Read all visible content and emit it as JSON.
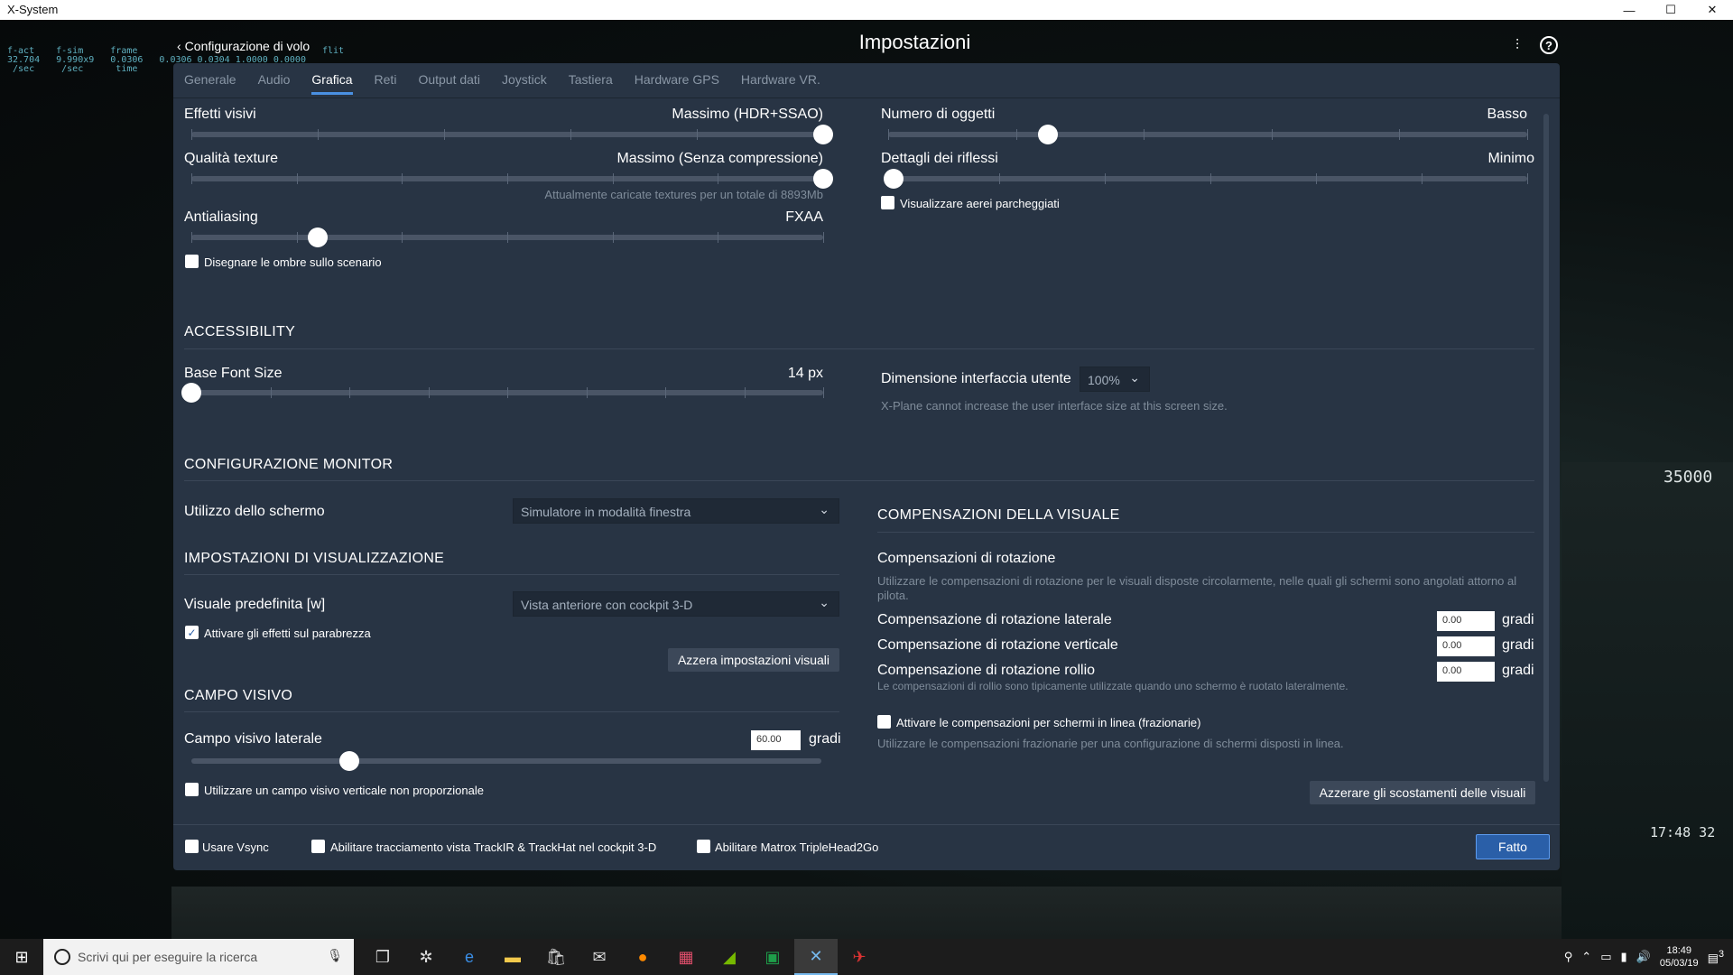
{
  "window": {
    "title": "X-System",
    "minimize": "—",
    "maximize": "☐",
    "close": "✕"
  },
  "stats": {
    "col1": "f-act\n32.704\n /sec",
    "col2": "f-sim\n9.990x9\n /sec",
    "col3": "frame\n0.0306\n time",
    "col4": "\n0.0306 0.0304 1.0000 0.0000",
    "col5": "flit\n"
  },
  "sim": {
    "altitude": "35000",
    "clock": "17:48 32"
  },
  "header": {
    "back_label": "Configurazione di volo",
    "title": "Impostazioni",
    "sliders_icon": "sliders-icon",
    "help_icon": "help-icon"
  },
  "tabs": [
    "Generale",
    "Audio",
    "Grafica",
    "Reti",
    "Output dati",
    "Joystick",
    "Tastiera",
    "Hardware GPS",
    "Hardware VR."
  ],
  "active_tab": "Grafica",
  "graphics": {
    "visual_effects": {
      "label": "Effetti visivi",
      "value": "Massimo (HDR+SSAO)",
      "level": 1.0,
      "ticks": 5
    },
    "texture_quality": {
      "label": "Qualità texture",
      "value": "Massimo (Senza compressione)",
      "level": 1.0,
      "ticks": 6,
      "note": "Attualmente caricate textures per un totale di 8893Mb"
    },
    "antialiasing": {
      "label": "Antialiasing",
      "value": "FXAA",
      "level": 0.2,
      "ticks": 6
    },
    "shadows": {
      "label": "Disegnare le ombre sullo scenario",
      "checked": false
    },
    "object_count": {
      "label": "Numero di oggetti",
      "value": "Basso",
      "level": 0.25,
      "ticks": 5
    },
    "reflection_detail": {
      "label": "Dettagli dei riflessi",
      "value": "Minimo",
      "level": 0.0,
      "ticks": 6
    },
    "parked_aircraft": {
      "label": "Visualizzare aerei parcheggiati",
      "checked": false
    }
  },
  "accessibility": {
    "title": "ACCESSIBILITY",
    "font_size": {
      "label": "Base Font Size",
      "value": "14 px",
      "level": 0.0,
      "ticks": 8
    },
    "ui_size": {
      "label": "Dimensione interfaccia utente",
      "value": "100%",
      "note": "X-Plane cannot increase the user interface size at this screen size."
    }
  },
  "monitor": {
    "title": "CONFIGURAZIONE MONITOR",
    "screen_usage": {
      "label": "Utilizzo dello schermo",
      "value": "Simulatore in modalità finestra"
    }
  },
  "display": {
    "title": "IMPOSTAZIONI DI VISUALIZZAZIONE",
    "default_view": {
      "label": "Visuale predefinita [w]",
      "value": "Vista anteriore con cockpit 3-D"
    },
    "windshield": {
      "label": "Attivare gli effetti sul parabrezza",
      "checked": true
    },
    "reset_button": "Azzera impostazioni visuali"
  },
  "fov": {
    "title": "CAMPO VISIVO",
    "lateral": {
      "label": "Campo visivo laterale",
      "value": "60.00",
      "unit": "gradi",
      "level": 0.25
    },
    "non_proportional": {
      "label": "Utilizzare un campo visivo verticale non proporzionale",
      "checked": false
    }
  },
  "offsets": {
    "title": "COMPENSAZIONI DELLA VISUALE",
    "rotation_title": "Compensazioni di rotazione",
    "rotation_desc": "Utilizzare le compensazioni di rotazione per le visuali disposte circolarmente, nelle quali gli schermi sono angolati attorno al pilota.",
    "lateral": {
      "label": "Compensazione di rotazione laterale",
      "value": "0.00",
      "unit": "gradi"
    },
    "vertical": {
      "label": "Compensazione di rotazione verticale",
      "value": "0.00",
      "unit": "gradi"
    },
    "roll": {
      "label": "Compensazione di rotazione rollio",
      "value": "0.00",
      "unit": "gradi"
    },
    "roll_note": "Le compensazioni di rollio sono tipicamente utilizzate quando uno schermo è ruotato lateralmente.",
    "inline": {
      "label": "Attivare le compensazioni per schermi in linea (frazionarie)",
      "checked": false
    },
    "inline_desc": "Utilizzare le compensazioni frazionarie per una configurazione di schermi disposti in linea.",
    "reset_button": "Azzerare gli scostamenti delle visuali"
  },
  "footer": {
    "vsync": {
      "label": "Usare Vsync",
      "checked": false
    },
    "trackir": {
      "label": "Abilitare tracciamento vista TrackIR & TrackHat nel cockpit 3-D",
      "checked": false
    },
    "matrox": {
      "label": "Abilitare Matrox TripleHead2Go",
      "checked": false
    },
    "done_button": "Fatto"
  },
  "taskbar": {
    "search_placeholder": "Scrivi qui per eseguire la ricerca",
    "time": "18:49",
    "date": "05/03/19",
    "notifications": "3"
  },
  "colors": {
    "accent": "#4a90e2",
    "panel": "#283444",
    "button_primary": "#2a5fa8"
  }
}
